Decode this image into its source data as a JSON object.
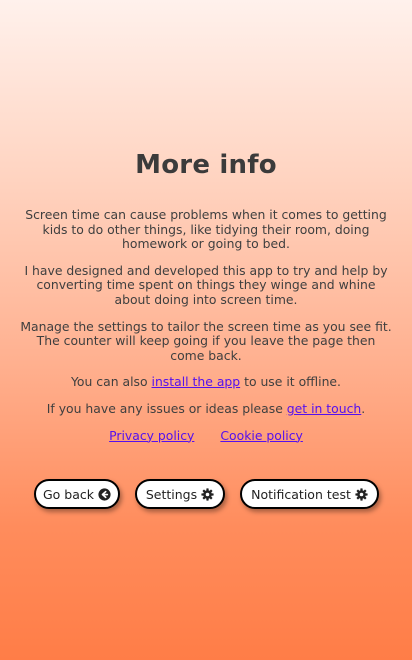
{
  "page": {
    "title": "More info",
    "paragraphs": {
      "p1": "Screen time can cause problems when it comes to getting kids to do other things, like tidying their room, doing homework or going to bed.",
      "p2": "I have designed and developed this app to try and help by converting time spent on things they winge and whine about doing into screen time.",
      "p3": "Manage the settings to tailor the screen time as you see fit. The counter will keep going if you leave the page then come back."
    },
    "install": {
      "prefix": "You can also ",
      "link": "install the app",
      "suffix": " to use it offline."
    },
    "contact": {
      "prefix": "If you have any issues or ideas please ",
      "link": "get in touch",
      "suffix": "."
    },
    "policies": {
      "privacy": "Privacy policy",
      "cookie": "Cookie policy"
    }
  },
  "buttons": {
    "back": {
      "label": "Go back",
      "icon": "arrow-circle-left-icon"
    },
    "settings": {
      "label": "Settings",
      "icon": "gear-icon"
    },
    "notification": {
      "label": "Notification test",
      "icon": "gear-icon"
    }
  },
  "colors": {
    "link": "#5511ee",
    "text": "#3f3f3f",
    "gradient_top": "#fff1ec",
    "gradient_bottom": "#ff7d47",
    "button_bg": "#ffffff",
    "button_border": "#000000"
  }
}
